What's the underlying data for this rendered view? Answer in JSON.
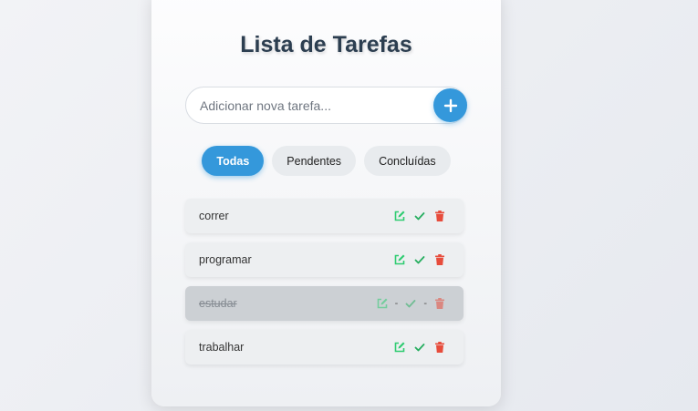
{
  "app": {
    "title": "Lista de Tarefas"
  },
  "input": {
    "placeholder": "Adicionar nova tarefa..."
  },
  "filters": [
    {
      "label": "Todas",
      "active": true
    },
    {
      "label": "Pendentes",
      "active": false
    },
    {
      "label": "Concluídas",
      "active": false
    }
  ],
  "tasks": [
    {
      "text": "correr",
      "completed": false
    },
    {
      "text": "programar",
      "completed": false
    },
    {
      "text": "estudar",
      "completed": true,
      "separator": "-"
    },
    {
      "text": "trabalhar",
      "completed": false
    }
  ],
  "icons": {
    "add": "plus-icon",
    "edit": "edit-icon",
    "complete": "check-icon",
    "delete": "trash-icon"
  },
  "colors": {
    "accent": "#3498db",
    "edit": "#2ecc71",
    "check": "#27ae60",
    "delete": "#e74c3c",
    "title": "#2c3e50"
  }
}
